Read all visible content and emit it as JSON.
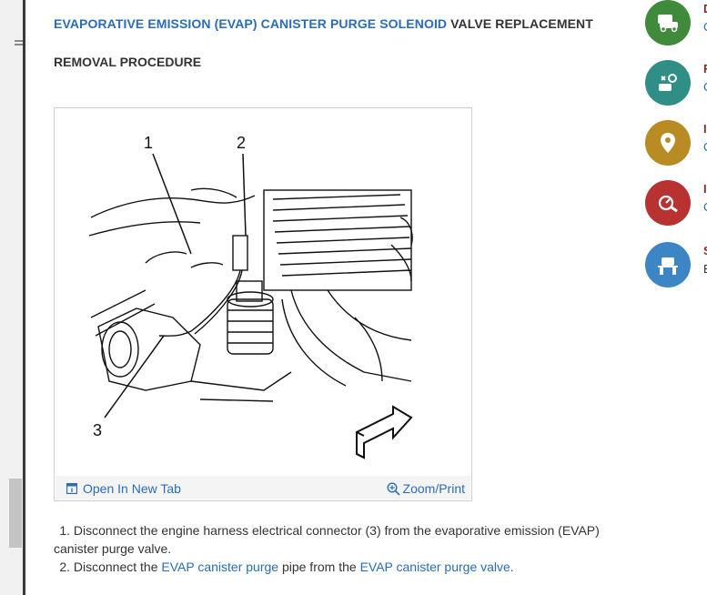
{
  "doc": {
    "title_link": "EVAPORATIVE EMISSION (EVAP) CANISTER PURGE SOLENOID",
    "title_rest": " VALVE REPLACEMENT",
    "subheading": "REMOVAL PROCEDURE"
  },
  "figure": {
    "callouts": [
      "1",
      "2",
      "3"
    ],
    "open_tab_label": "Open In New Tab",
    "zoom_label": "Zoom/Print"
  },
  "steps": [
    {
      "number": "1.",
      "text": "Disconnect the engine harness electrical connector (3) from the evaporative emission (EVAP) canister purge valve."
    },
    {
      "number": "2.",
      "text_before": "Disconnect the ",
      "link1": "EVAP canister purge",
      "text_middle": " pipe from the ",
      "link2": "EVAP canister purge valve."
    }
  ],
  "sidebar": {
    "icons": [
      {
        "icon": "car-service-icon",
        "color": "#3f8a3b",
        "label": "D",
        "sub": "C"
      },
      {
        "icon": "parts-icon",
        "color": "#2f8f86",
        "label": "F",
        "sub": "C"
      },
      {
        "icon": "location-pin-icon",
        "color": "#b98b24",
        "label": "I",
        "sub": "C"
      },
      {
        "icon": "diagnostic-icon",
        "color": "#b83232",
        "label": "I",
        "sub": "C"
      },
      {
        "icon": "vehicle-lift-icon",
        "color": "#3d86c6",
        "label": "S",
        "sub": "E"
      }
    ]
  }
}
